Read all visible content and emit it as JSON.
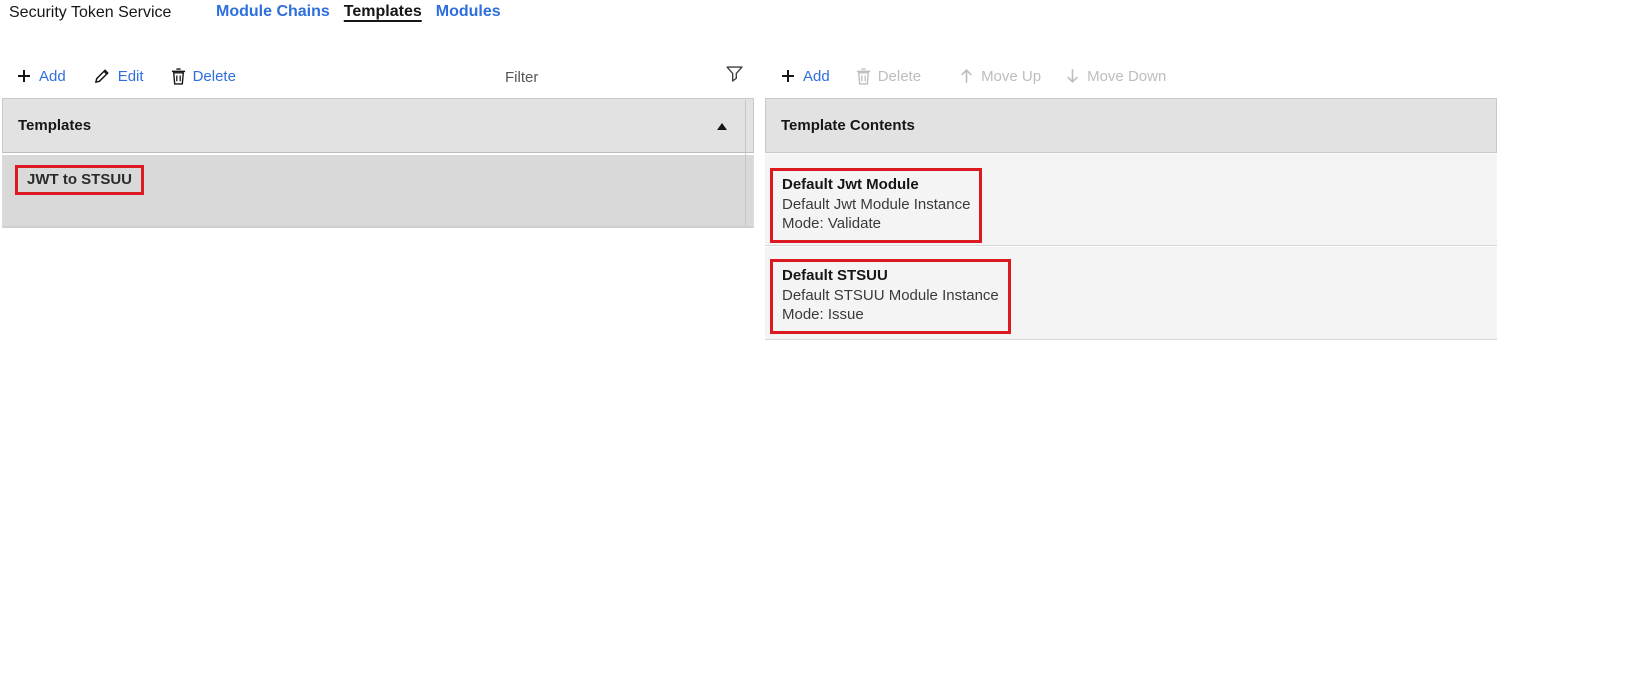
{
  "header": {
    "title": "Security Token Service",
    "nav": [
      {
        "label": "Module Chains",
        "active": false
      },
      {
        "label": "Templates",
        "active": true
      },
      {
        "label": "Modules",
        "active": false
      }
    ]
  },
  "left_panel": {
    "toolbar": {
      "add_label": "Add",
      "edit_label": "Edit",
      "delete_label": "Delete",
      "filter_placeholder": "Filter"
    },
    "table": {
      "header": "Templates",
      "sort_state": "ascending",
      "rows": [
        {
          "name": "JWT to STSUU",
          "highlighted": true,
          "selected": true
        }
      ]
    }
  },
  "right_panel": {
    "toolbar": {
      "add_label": "Add",
      "delete_label": "Delete",
      "move_up_label": "Move Up",
      "move_down_label": "Move Down",
      "disabled_items": [
        "Delete",
        "Move Up",
        "Move Down"
      ]
    },
    "table": {
      "header": "Template Contents",
      "rows": [
        {
          "title": "Default Jwt Module",
          "subtitle": "Default Jwt Module Instance",
          "mode": "Mode: Validate",
          "highlighted": true
        },
        {
          "title": "Default STSUU",
          "subtitle": "Default STSUU Module Instance",
          "mode": "Mode: Issue",
          "highlighted": true
        }
      ]
    }
  },
  "icons": {
    "add": "plus-icon",
    "edit": "pencil-icon",
    "delete": "trash-icon",
    "filter": "funnel-icon",
    "move_up": "arrow-up-icon",
    "move_down": "arrow-down-icon",
    "sort": "sort-ascending-icon"
  },
  "colors": {
    "link_blue": "#2d6fdd",
    "disabled_gray": "#bdbdbd",
    "table_header_bg": "#e2e2e2",
    "selected_row_bg": "#d9d9d9",
    "content_row_bg": "#f4f4f4",
    "annotation_red": "#dd1a1f",
    "text_primary": "#161616"
  }
}
